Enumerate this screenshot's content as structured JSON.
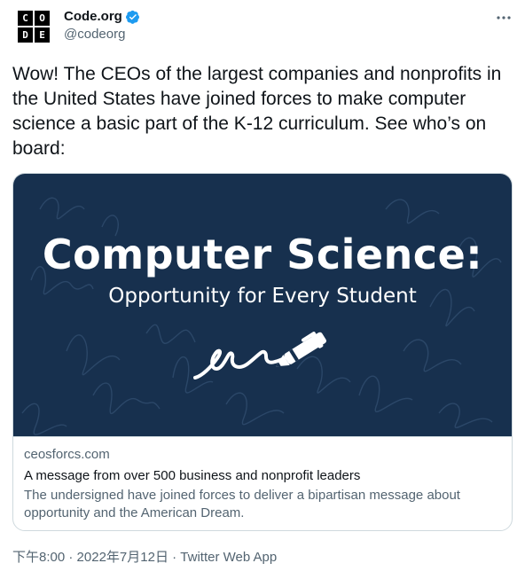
{
  "author": {
    "name": "Code.org",
    "handle": "@codeorg",
    "logo_letters": [
      "C",
      "O",
      "D",
      "E"
    ],
    "verified_icon": "verified-badge-icon",
    "verified_color": "#1d9bf0"
  },
  "more_icon": "more-horizontal-icon",
  "tweet": {
    "text": "Wow! The CEOs of the largest companies and nonprofits in the United States have joined forces to make computer science a basic part of the K-12 curriculum. See who’s on board:"
  },
  "card": {
    "image": {
      "title": "Computer Science:",
      "subtitle": "Opportunity for Every Student",
      "background": "#17304e",
      "pen_icon": "pen-signature-icon"
    },
    "domain": "ceosforcs.com",
    "title": "A message from over 500 business and nonprofit leaders",
    "description": "The undersigned have joined forces to deliver a bipartisan message about opportunity and the American Dream."
  },
  "footer": {
    "time": "下午8:00",
    "separator1": " · ",
    "date": "2022年7月12日",
    "separator2": " · ",
    "source": "Twitter Web App"
  }
}
